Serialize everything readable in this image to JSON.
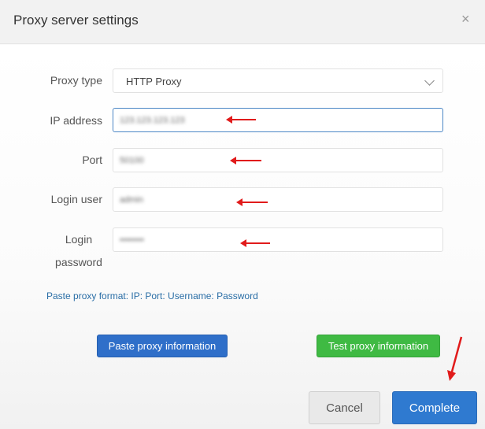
{
  "dialog": {
    "title": "Proxy server settings",
    "close_label": "×"
  },
  "form": {
    "proxy_type_label": "Proxy type",
    "proxy_type_value": "HTTP Proxy",
    "ip_label": "IP address",
    "ip_value": "123.123.123.123",
    "port_label": "Port",
    "port_value": "50100",
    "login_user_label": "Login user",
    "login_user_value": "admin",
    "login_password_label_line1": "Login",
    "login_password_label_line2": "password",
    "login_password_value": "••••••••"
  },
  "hint": "Paste proxy format: IP: Port: Username: Password",
  "buttons": {
    "paste": "Paste proxy information",
    "test": "Test proxy information",
    "cancel": "Cancel",
    "complete": "Complete"
  },
  "colors": {
    "annotation_arrow": "#e11b1b",
    "primary_blue": "#2f6fc9",
    "test_green": "#3fba43"
  },
  "icons": [
    "close-icon",
    "chevron-down-icon",
    "annotation-arrow-icon"
  ]
}
